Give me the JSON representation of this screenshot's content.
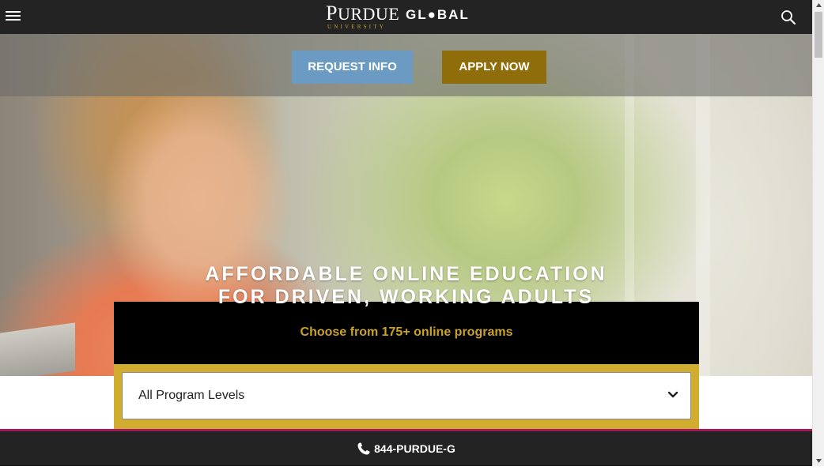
{
  "header": {
    "logo_main_first": "P",
    "logo_main_rest": "URDUE",
    "logo_global": "GL●BAL",
    "logo_sub": "UNIVERSITY",
    "menu_icon": "hamburger-icon",
    "search_icon": "search-icon"
  },
  "hero": {
    "request_label": "REQUEST INFO",
    "apply_label": "APPLY NOW",
    "headline_line1": "AFFORDABLE ONLINE EDUCATION",
    "headline_line2": "FOR DRIVEN, WORKING ADULTS"
  },
  "program_finder": {
    "subtitle": "Choose from 175+ online programs",
    "select_value": "All Program Levels",
    "chevron_icon": "chevron-down-icon"
  },
  "footer_bar": {
    "phone": "844-PURDUE-G",
    "phone_icon": "phone-icon"
  },
  "colors": {
    "nav_bg": "#232323",
    "request_btn": "#6b9bc3",
    "apply_btn": "#8e6d0a",
    "gold": "#d0ad2e",
    "accent_text": "#c9a227",
    "pink_line": "#a3195b"
  }
}
